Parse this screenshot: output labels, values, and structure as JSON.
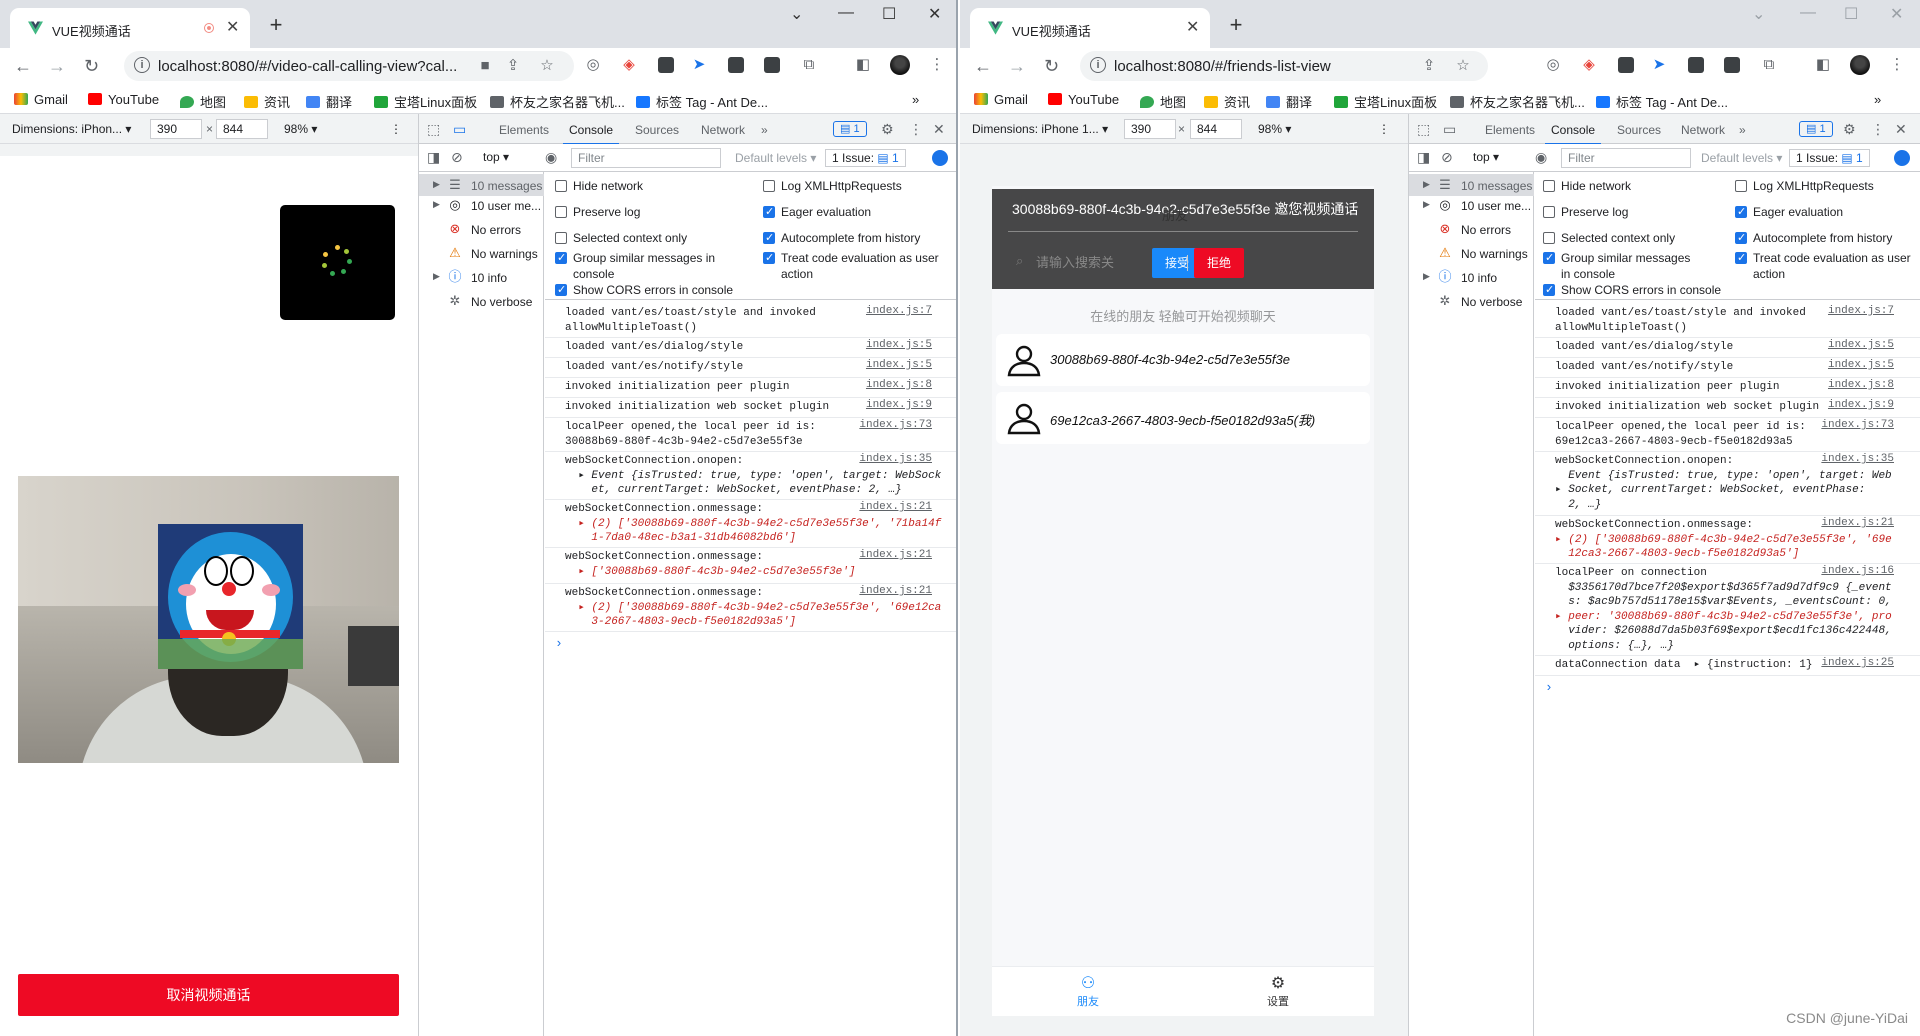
{
  "left": {
    "tab_title": "VUE视频通话",
    "url": "localhost:8080/#/video-call-calling-view?cal...",
    "bookmarks": [
      "Gmail",
      "YouTube",
      "地图",
      "资讯",
      "翻译",
      "宝塔Linux面板",
      "杯友之家名器飞机...",
      "标签 Tag - Ant De..."
    ],
    "device": {
      "label": "Dimensions: iPhon...",
      "width": "390",
      "height": "844",
      "zoom": "98%"
    },
    "cancel_label": "取消视频通话",
    "devtools": {
      "tabs": [
        "Elements",
        "Console",
        "Sources",
        "Network"
      ],
      "message_badge": "1",
      "context": "top",
      "filter_placeholder": "Filter",
      "levels": "Default levels",
      "issue": "1 Issue:",
      "issue_count": "1",
      "sidebar": [
        "10 messages",
        "10 user me...",
        "No errors",
        "No warnings",
        "10 info",
        "No verbose"
      ],
      "settings": [
        {
          "label": "Hide network",
          "checked": false
        },
        {
          "label": "Log XMLHttpRequests",
          "checked": false
        },
        {
          "label": "Preserve log",
          "checked": false
        },
        {
          "label": "Eager evaluation",
          "checked": true
        },
        {
          "label": "Selected context only",
          "checked": false
        },
        {
          "label": "Autocomplete from history",
          "checked": true
        },
        {
          "label": "Group similar messages in console",
          "checked": true
        },
        {
          "label": "Treat code evaluation as user action",
          "checked": true
        },
        {
          "label": "Show CORS errors in console",
          "checked": true
        }
      ],
      "logs": [
        {
          "lines": [
            "loaded vant/es/toast/style and invoked",
            "allowMultipleToast()"
          ],
          "src": "index.js:7"
        },
        {
          "lines": [
            "loaded vant/es/dialog/style"
          ],
          "src": "index.js:5"
        },
        {
          "lines": [
            "loaded vant/es/notify/style"
          ],
          "src": "index.js:5"
        },
        {
          "lines": [
            "invoked initialization peer plugin"
          ],
          "src": "index.js:8"
        },
        {
          "lines": [
            "invoked initialization web socket plugin"
          ],
          "src": "index.js:9"
        },
        {
          "lines": [
            "localPeer opened,the local peer id is:",
            "30088b69-880f-4c3b-94e2-c5d7e3e55f3e"
          ],
          "src": "index.js:73"
        },
        {
          "lines": [
            "webSocketConnection.onopen:",
            "  ▸ Event {isTrusted: true, type: 'open', target: WebSock",
            "    et, currentTarget: WebSocket, eventPhase: 2, …}"
          ],
          "src": "index.js:35"
        },
        {
          "lines": [
            "webSocketConnection.onmessage:",
            "  ▸ (2) ['30088b69-880f-4c3b-94e2-c5d7e3e55f3e', '71ba14f",
            "    1-7da0-48ec-b3a1-31db46082bd6']"
          ],
          "src": "index.js:21"
        },
        {
          "lines": [
            "webSocketConnection.onmessage:",
            "  ▸ ['30088b69-880f-4c3b-94e2-c5d7e3e55f3e']"
          ],
          "src": "index.js:21"
        },
        {
          "lines": [
            "webSocketConnection.onmessage:",
            "  ▸ (2) ['30088b69-880f-4c3b-94e2-c5d7e3e55f3e', '69e12ca",
            "    3-2667-4803-9ecb-f5e0182d93a5']"
          ],
          "src": "index.js:21"
        }
      ]
    }
  },
  "right": {
    "tab_title": "VUE视频通话",
    "url": "localhost:8080/#/friends-list-view",
    "bookmarks": [
      "Gmail",
      "YouTube",
      "地图",
      "资讯",
      "翻译",
      "宝塔Linux面板",
      "杯友之家名器飞机...",
      "标签 Tag - Ant De..."
    ],
    "device": {
      "label": "Dimensions: iPhone 1...",
      "width": "390",
      "height": "844",
      "zoom": "98%"
    },
    "invite_text": "30088b69-880f-4c3b-94e2-c5d7e3e55f3e 邀您视频通话",
    "invite_overlap_title": "朋友",
    "search_placeholder": "请输入搜索关",
    "accept_label": "接受",
    "reject_label": "拒绝",
    "subtitle": "在线的朋友 轻触可开始视频聊天",
    "friends": [
      "30088b69-880f-4c3b-94e2-c5d7e3e55f3e",
      "69e12ca3-2667-4803-9ecb-f5e0182d93a5(我)"
    ],
    "tabbar": [
      "朋友",
      "设置"
    ],
    "devtools": {
      "tabs": [
        "Elements",
        "Console",
        "Sources",
        "Network"
      ],
      "message_badge": "1",
      "context": "top",
      "filter_placeholder": "Filter",
      "levels": "Default levels",
      "issue": "1 Issue:",
      "issue_count": "1",
      "sidebar": [
        "10 messages",
        "10 user me...",
        "No errors",
        "No warnings",
        "10 info",
        "No verbose"
      ],
      "settings": [
        {
          "label": "Hide network",
          "checked": false
        },
        {
          "label": "Log XMLHttpRequests",
          "checked": false
        },
        {
          "label": "Preserve log",
          "checked": false
        },
        {
          "label": "Eager evaluation",
          "checked": true
        },
        {
          "label": "Selected context only",
          "checked": false
        },
        {
          "label": "Autocomplete from history",
          "checked": true
        },
        {
          "label": "Group similar messages in console",
          "checked": true
        },
        {
          "label": "Treat code evaluation as user action",
          "checked": true
        },
        {
          "label": "Show CORS errors in console",
          "checked": true
        }
      ],
      "logs": [
        {
          "lines": [
            "loaded vant/es/toast/style and invoked",
            "allowMultipleToast()"
          ],
          "src": "index.js:7"
        },
        {
          "lines": [
            "loaded vant/es/dialog/style"
          ],
          "src": "index.js:5"
        },
        {
          "lines": [
            "loaded vant/es/notify/style"
          ],
          "src": "index.js:5"
        },
        {
          "lines": [
            "invoked initialization peer plugin"
          ],
          "src": "index.js:8"
        },
        {
          "lines": [
            "invoked initialization web socket plugin"
          ],
          "src": "index.js:9"
        },
        {
          "lines": [
            "localPeer opened,the local peer id is:",
            "69e12ca3-2667-4803-9ecb-f5e0182d93a5"
          ],
          "src": "index.js:73"
        },
        {
          "lines": [
            "webSocketConnection.onopen:",
            "  Event {isTrusted: true, type: 'open', target: Web",
            "▸ Socket, currentTarget: WebSocket, eventPhase:",
            "  2, …}"
          ],
          "src": "index.js:35"
        },
        {
          "lines": [
            "webSocketConnection.onmessage:",
            "▸ (2) ['30088b69-880f-4c3b-94e2-c5d7e3e55f3e', '69e",
            "  12ca3-2667-4803-9ecb-f5e0182d93a5']"
          ],
          "src": "index.js:21"
        },
        {
          "lines": [
            "localPeer on connection",
            "  $3356170d7bce7f20$export$d365f7ad9d7df9c9 {_event",
            "  s: $ac9b757d51178e15$var$Events, _eventsCount: 0,",
            "▸ peer: '30088b69-880f-4c3b-94e2-c5d7e3e55f3e', pro",
            "  vider: $26088d7da5b03f69$export$ecd1fc136c422448,",
            "  options: {…}, …}"
          ],
          "src": "index.js:16"
        },
        {
          "lines": [
            "dataConnection data  ▸ {instruction: 1}"
          ],
          "src": "index.js:25"
        }
      ]
    }
  },
  "watermark": "CSDN @june-YiDai"
}
